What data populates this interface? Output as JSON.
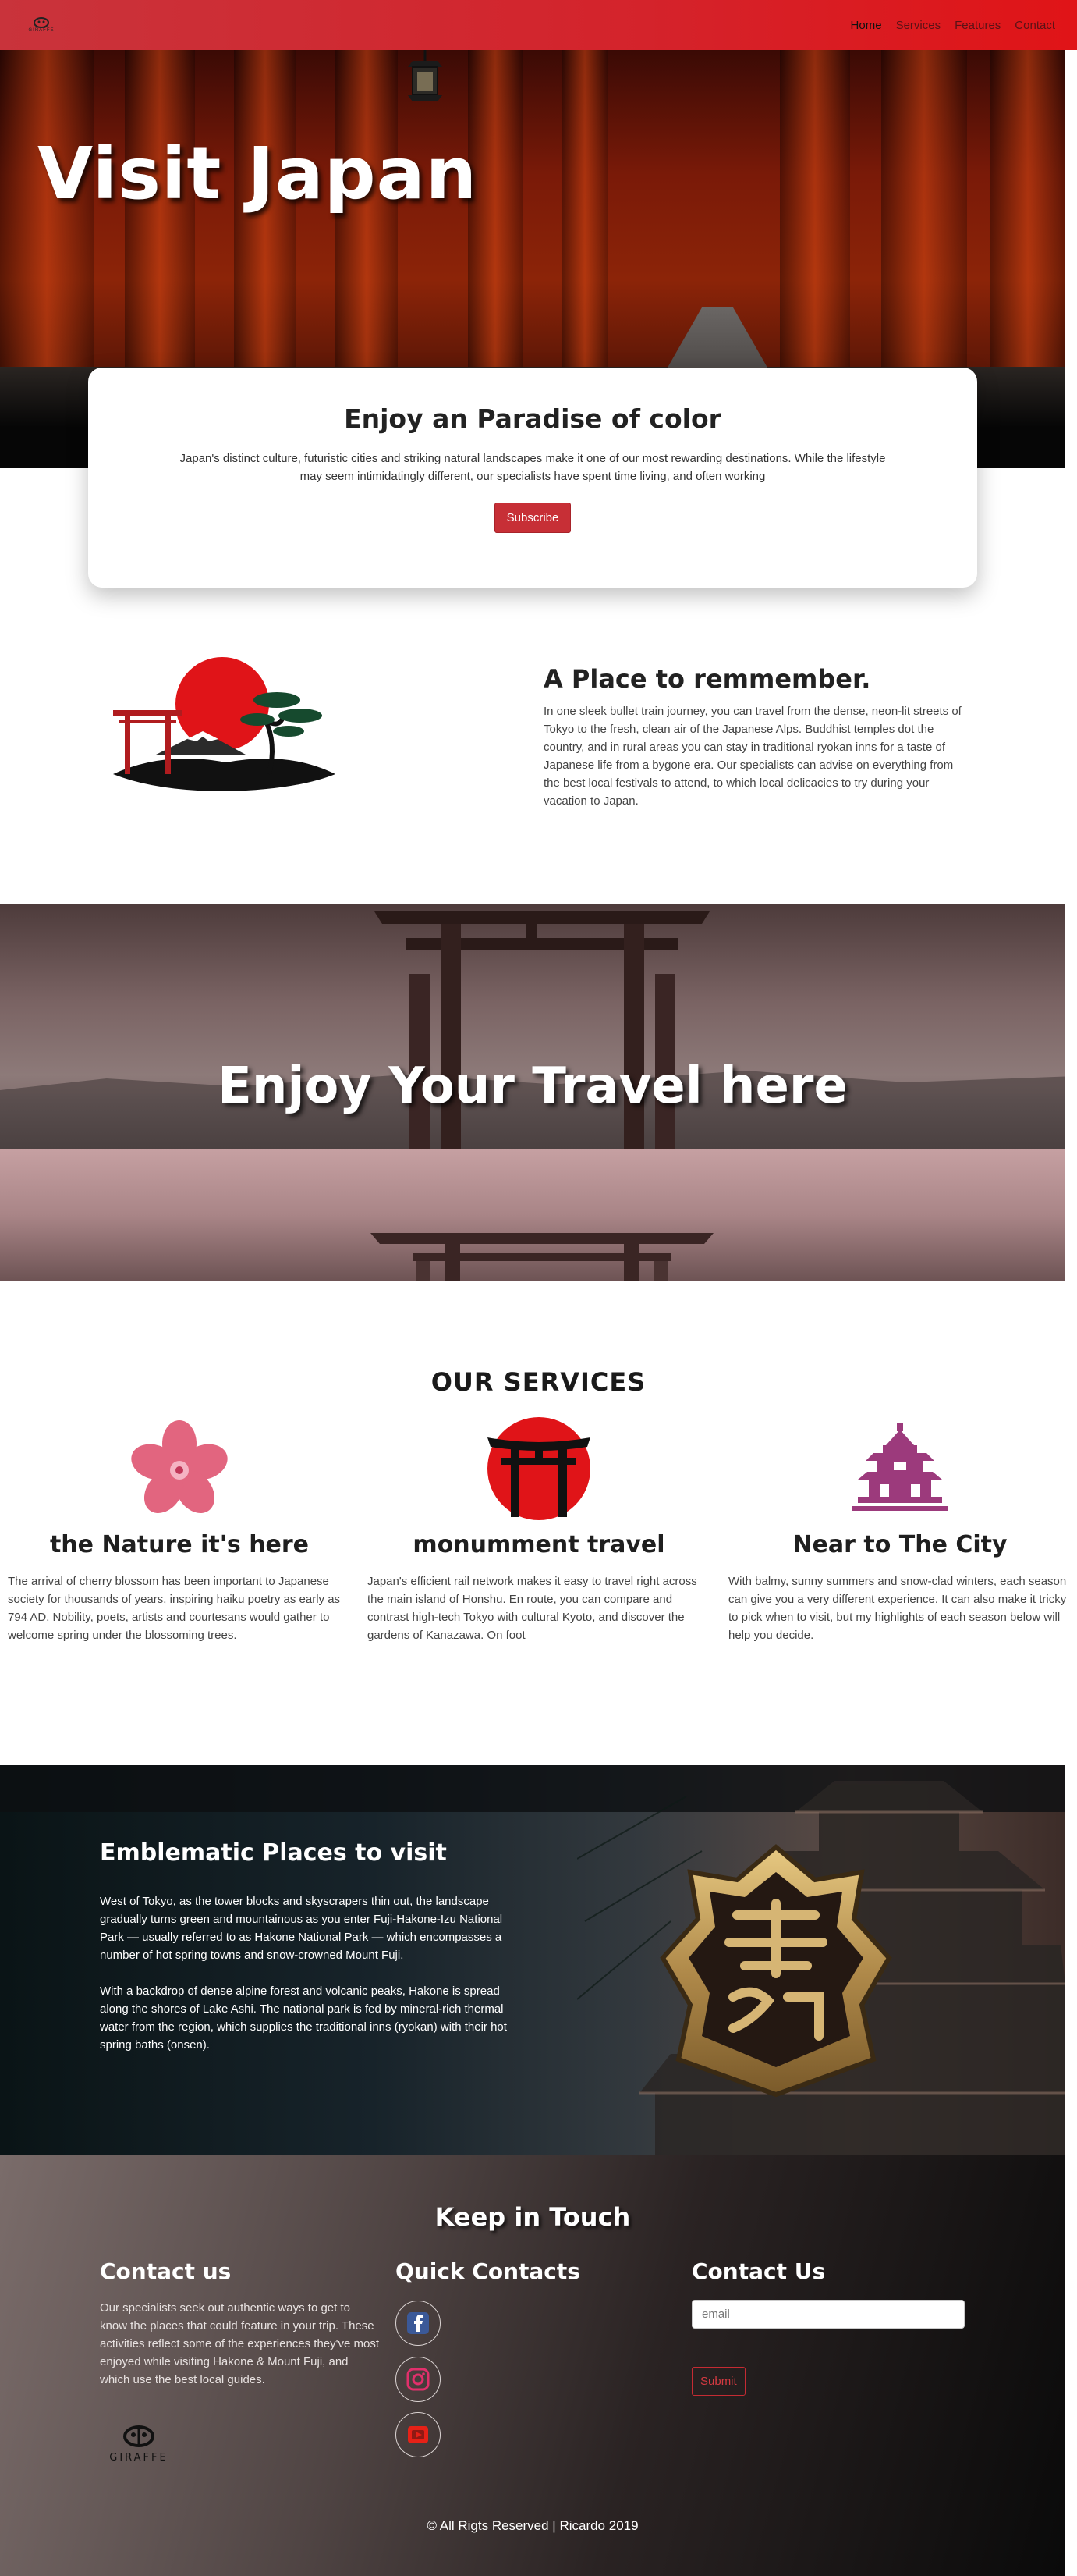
{
  "nav": {
    "brand_name": "GIRAFFE",
    "links": [
      "Home",
      "Services",
      "Features",
      "Contact"
    ]
  },
  "hero": {
    "title": "Visit Japan"
  },
  "intro_card": {
    "title": "Enjoy an Paradise of color",
    "text": "Japan's distinct culture, futuristic cities and striking natural landscapes make it one of our most rewarding destinations. While the lifestyle may seem intimidatingly different, our specialists have spent time living, and often working",
    "button": "Subscribe"
  },
  "place": {
    "title": "A Place to remmember.",
    "text": "In one sleek bullet train journey, you can travel from the dense, neon-lit streets of Tokyo to the fresh, clean air of the Japanese Alps. Buddhist temples dot the country, and in rural areas you can stay in traditional ryokan inns for a taste of Japanese life from a bygone era. Our specialists can advise on everything from the best local festivals to attend, to which local delicacies to try during your vacation to Japan."
  },
  "banner": {
    "title": "Enjoy Your Travel here"
  },
  "services": {
    "title": "OUR SERVICES",
    "items": [
      {
        "icon": "cherry-blossom-icon",
        "title": "the Nature it's here",
        "text": "The arrival of cherry blossom has been important to Japanese society for thousands of years, inspiring haiku poetry as early as 794 AD. Nobility, poets, artists and courtesans would gather to welcome spring under the blossoming trees."
      },
      {
        "icon": "torii-gate-icon",
        "title": "monumment travel",
        "text": "Japan's efficient rail network makes it easy to travel right across the main island of Honshu. En route, you can compare and contrast high-tech Tokyo with cultural Kyoto, and discover the gardens of Kanazawa. On foot"
      },
      {
        "icon": "pagoda-icon",
        "title": "Near to The City",
        "text": "With balmy, sunny summers and snow-clad winters, each season can give you a very different experience. It can also make it tricky to pick when to visit, but my highlights of each season below will help you decide."
      }
    ]
  },
  "emblematic": {
    "title": "Emblematic Places to visit",
    "p1": "West of Tokyo, as the tower blocks and skyscrapers thin out, the landscape gradually turns green and mountainous as you enter Fuji-Hakone-Izu National Park — usually referred to as Hakone National Park — which encompasses a number of hot spring towns and snow-crowned Mount Fuji.",
    "p2": "With a backdrop of dense alpine forest and volcanic peaks, Hakone is spread along the shores of Lake Ashi. The national park is fed by mineral-rich thermal water from the region, which supplies the traditional inns (ryokan) with their hot spring baths (onsen)."
  },
  "footer": {
    "title": "Keep in Touch",
    "contact_title": "Contact us",
    "contact_text": "Our specialists seek out authentic ways to get to know the places that could feature in your trip. These activities reflect some of the experiences they've most enjoyed while visiting Hakone & Mount Fuji, and which use the best local guides.",
    "logo_text": "GIRAFFE",
    "quick_title": "Quick Contacts",
    "socials": [
      "facebook-icon",
      "instagram-icon",
      "youtube-icon"
    ],
    "form_title": "Contact Us",
    "email_placeholder": "email",
    "submit": "Submit",
    "copyright": "© All Rigts Reserved | Ricardo 2019"
  },
  "colors": {
    "accent_red": "#c72f36",
    "nav_red": "#d4232b",
    "facebook_blue": "#3b5998",
    "instagram_pink": "#e1306c",
    "youtube_red": "#e62117"
  }
}
